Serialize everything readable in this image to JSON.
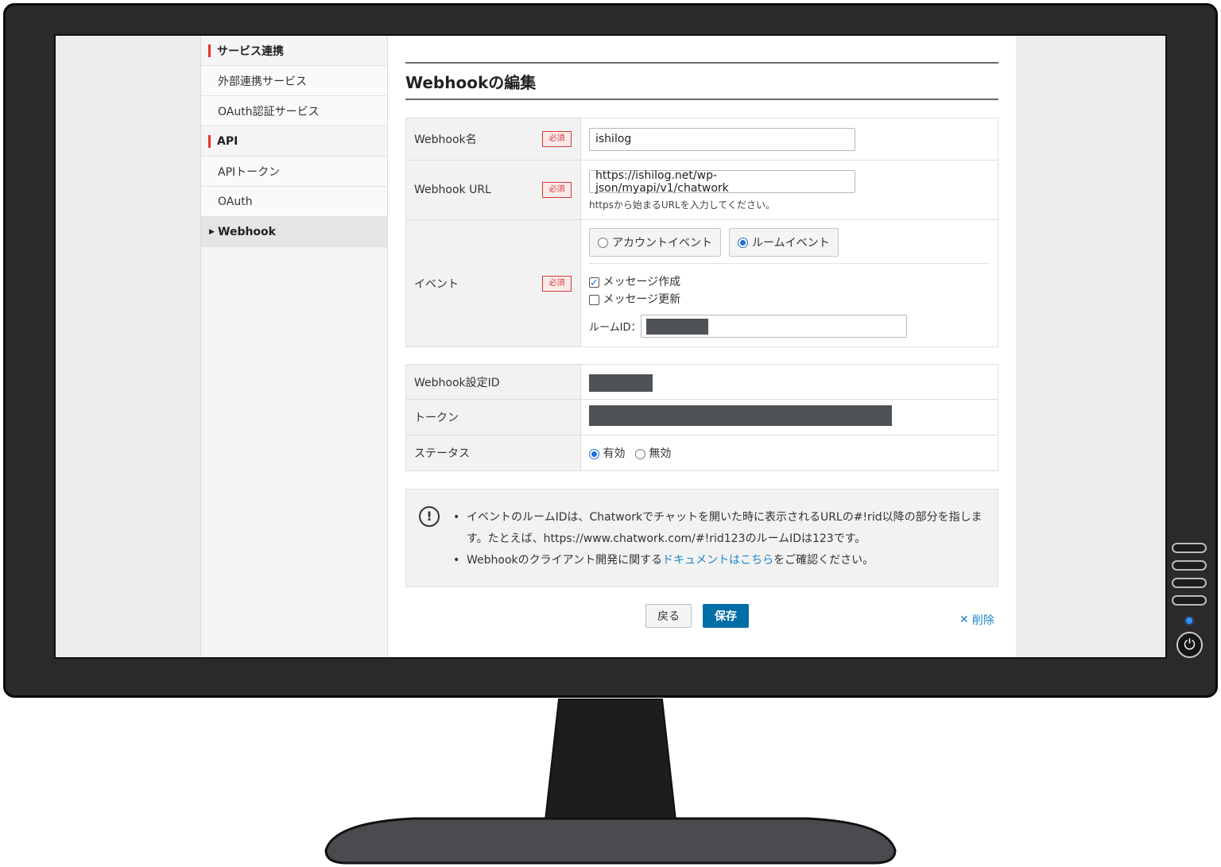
{
  "sidebar": {
    "sections": [
      {
        "label": "サービス連携",
        "items": [
          "外部連携サービス",
          "OAuth認証サービス"
        ]
      },
      {
        "label": "API",
        "items": [
          "APIトークン",
          "OAuth"
        ]
      }
    ],
    "active_item": "Webhook"
  },
  "page": {
    "title": "Webhookの編集"
  },
  "form": {
    "required_badge": "必須",
    "name": {
      "label": "Webhook名",
      "value": "ishilog"
    },
    "url": {
      "label": "Webhook URL",
      "value": "https://ishilog.net/wp-json/myapi/v1/chatwork",
      "hint": "httpsから始まるURLを入力してください。"
    },
    "event": {
      "label": "イベント",
      "types": [
        {
          "label": "アカウントイベント",
          "selected": false
        },
        {
          "label": "ルームイベント",
          "selected": true
        }
      ],
      "checkboxes": [
        {
          "label": "メッセージ作成",
          "checked": true
        },
        {
          "label": "メッセージ更新",
          "checked": false
        }
      ],
      "room_id_label": "ルームID："
    }
  },
  "info": {
    "setting_id_label": "Webhook設定ID",
    "token_label": "トークン",
    "status": {
      "label": "ステータス",
      "options": [
        {
          "label": "有効",
          "selected": true
        },
        {
          "label": "無効",
          "selected": false
        }
      ]
    }
  },
  "notice": {
    "icon": "exclamation-circle-icon",
    "line1": "イベントのルームIDは、Chatworkでチャットを開いた時に表示されるURLの#!rid以降の部分を指します。たとえば、https://www.chatwork.com/#!rid123のルームIDは123です。",
    "line2_prefix": "Webhookのクライアント開発に関する",
    "line2_link": "ドキュメントはこちら",
    "line2_suffix": "をご確認ください。"
  },
  "actions": {
    "back": "戻る",
    "save": "保存",
    "delete_icon": "close-icon",
    "delete": "削除"
  },
  "colors": {
    "accent": "#006ea7",
    "required": "#d43a3a",
    "link": "#1b86c7",
    "section_marker": "#e4312b"
  }
}
